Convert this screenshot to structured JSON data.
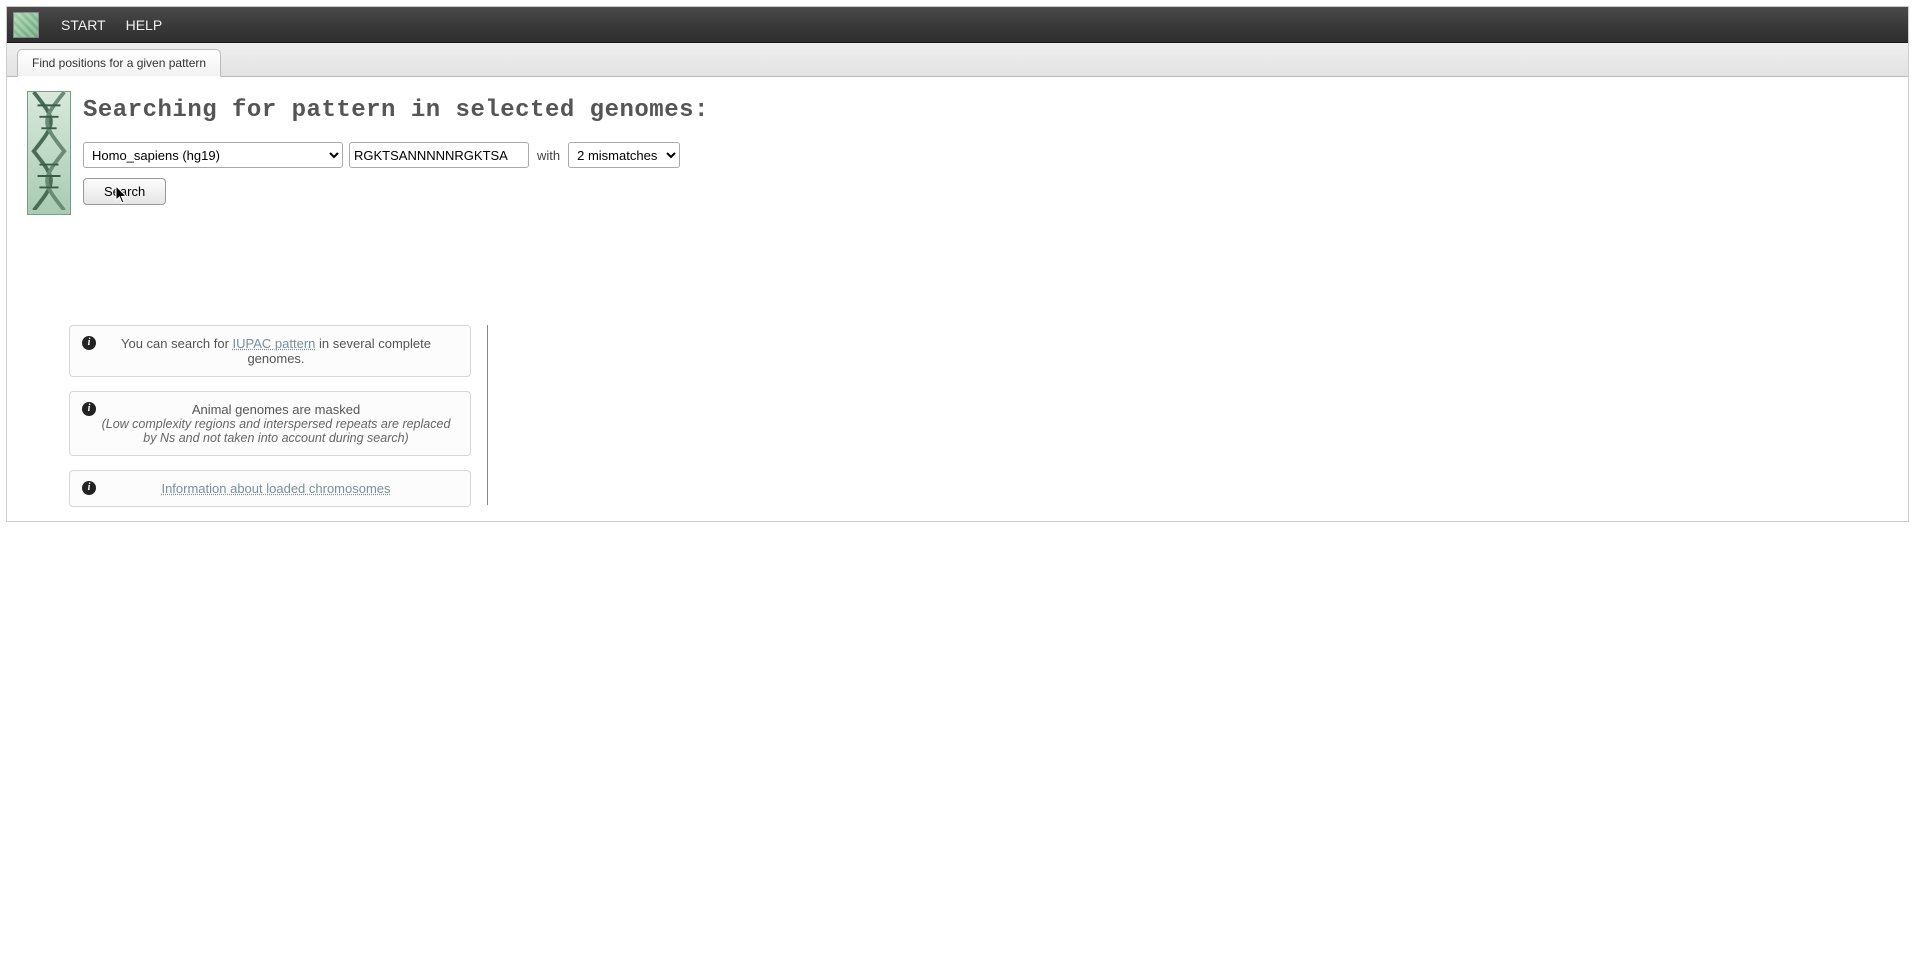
{
  "topbar": {
    "menu": {
      "start": "START",
      "help": "HELP"
    }
  },
  "tab": {
    "label": "Find positions for a given pattern"
  },
  "page": {
    "title": "Searching for pattern in selected genomes:"
  },
  "form": {
    "genome_selected": "Homo_sapiens (hg19)",
    "pattern_value": "RGKTSANNNNNRGKTSA",
    "with_label": "with",
    "mismatch_selected": "2 mismatches",
    "search_label": "Search"
  },
  "info": {
    "box1": {
      "pre": "You can search for ",
      "link": "IUPAC pattern",
      "post": " in several complete genomes."
    },
    "box2": {
      "title": "Animal genomes are masked",
      "note": "(Low complexity regions and interspersed repeats are replaced by Ns and not taken into account during search)"
    },
    "box3": {
      "link": "Information about loaded chromosomes"
    }
  }
}
